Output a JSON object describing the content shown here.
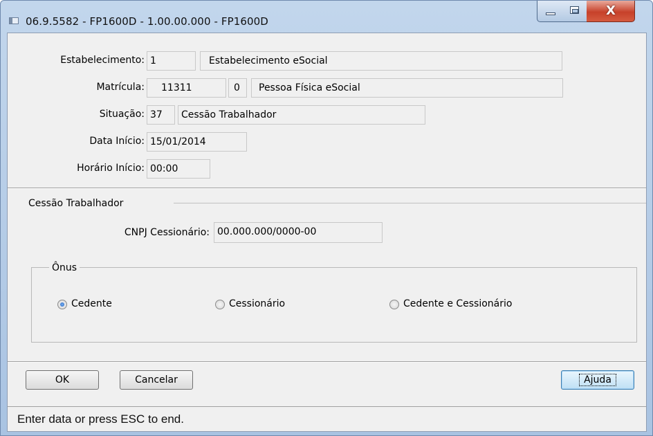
{
  "window": {
    "title": "06.9.5582 - FP1600D - 1.00.00.000 - FP1600D",
    "controls": {
      "close_glyph": "X"
    },
    "icons": [
      "app-icon",
      "minimize-icon",
      "maximize-icon",
      "close-icon"
    ]
  },
  "form": {
    "estabelecimento": {
      "label": "Estabelecimento:",
      "code": "1",
      "name": "Estabelecimento eSocial"
    },
    "matricula": {
      "label": "Matrícula:",
      "number": "11311",
      "digit": "0",
      "name": "Pessoa Física eSocial"
    },
    "situacao": {
      "label": "Situação:",
      "code": "37",
      "description": "Cessão Trabalhador"
    },
    "data_inicio": {
      "label": "Data Início:",
      "value": "15/01/2014"
    },
    "horario_inicio": {
      "label": "Horário Início:",
      "value": "00:00"
    }
  },
  "cessao": {
    "group_title": "Cessão Trabalhador",
    "cnpj": {
      "label": "CNPJ Cessionário:",
      "value": "00.000.000/0000-00"
    },
    "onus": {
      "title": "Ônus",
      "options": [
        "Cedente",
        "Cessionário",
        "Cedente e Cessionário"
      ],
      "selected": "Cedente"
    }
  },
  "buttons": {
    "ok": "OK",
    "cancel": "Cancelar",
    "help": "Ajuda"
  },
  "status": {
    "text": "Enter data or press ESC to end."
  },
  "colors": {
    "frame": "#b9cfe8",
    "client": "#f0f0f0",
    "close_button": "#c7412a",
    "radio_selected": "#1a5fc2"
  }
}
